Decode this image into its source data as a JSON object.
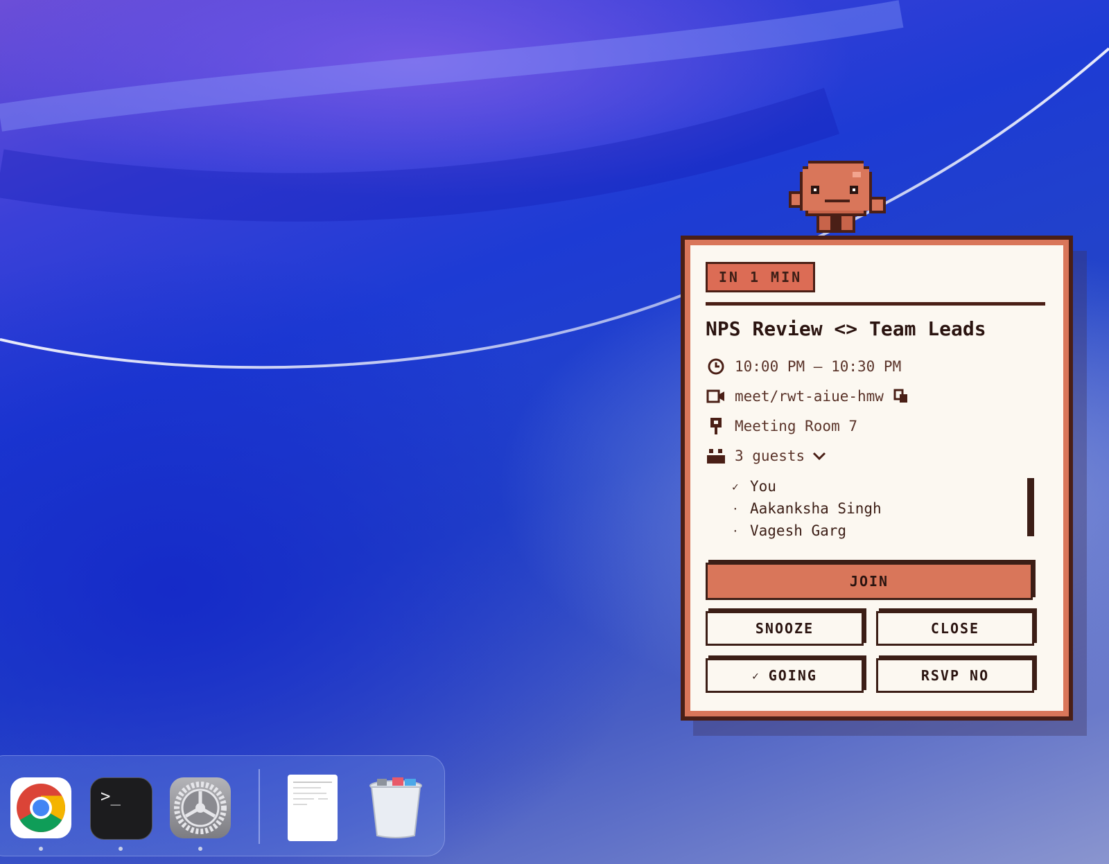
{
  "notification": {
    "badge": "IN 1 MIN",
    "title": "NPS Review <> Team Leads",
    "time": "10:00 PM – 10:30 PM",
    "meet_link": "meet/rwt-aiue-hmw",
    "location": "Meeting Room 7",
    "guests_label": "3 guests",
    "guests": [
      {
        "name": "You",
        "mark": "✓"
      },
      {
        "name": "Aakanksha Singh",
        "mark": "·"
      },
      {
        "name": "Vagesh Garg",
        "mark": "·"
      }
    ],
    "buttons": {
      "join": "JOIN",
      "snooze": "SNOOZE",
      "close": "CLOSE",
      "going": "GOING",
      "going_mark": "✓",
      "rsvp_no": "RSVP NO"
    },
    "icons": [
      "clock-icon",
      "video-icon",
      "copy-icon",
      "location-pin-icon",
      "people-icon",
      "chevron-down-icon"
    ]
  },
  "dock": {
    "apps": [
      {
        "name": "Google Chrome",
        "icon": "chrome-icon",
        "running": true
      },
      {
        "name": "Terminal",
        "icon": "terminal-icon",
        "running": true
      },
      {
        "name": "System Settings",
        "icon": "settings-gear-icon",
        "running": true
      },
      {
        "name": "Document",
        "icon": "document-icon",
        "running": false
      },
      {
        "name": "Trash",
        "icon": "trash-icon",
        "running": false
      }
    ],
    "terminal_prompt": ">_"
  },
  "colors": {
    "accent": "#d9765a",
    "border": "#4a1f16",
    "card_bg": "#fcf8f1"
  }
}
